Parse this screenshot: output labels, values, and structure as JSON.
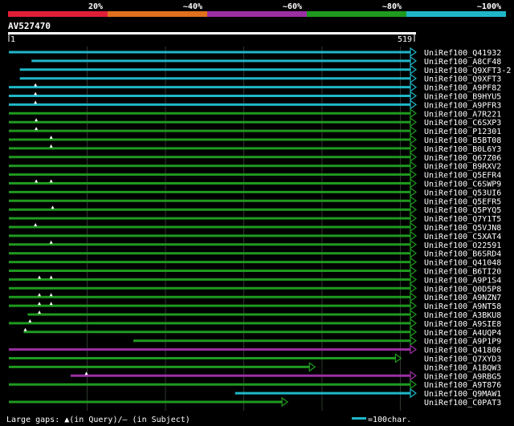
{
  "colors": {
    "background": "#000000",
    "text": "#ffffff",
    "grid": "#2e3a2e",
    "ruler": "#ffffff",
    "bin_lt20": "#e01e37",
    "bin_40": "#e0701e",
    "bin_60": "#9b2fa3",
    "bin_80": "#1f9a1f",
    "bin_100": "#1fb7c8"
  },
  "legend": {
    "bins": [
      {
        "label": "20%",
        "color": "#e01e37"
      },
      {
        "label": "~40%",
        "color": "#e0701e"
      },
      {
        "label": "~60%",
        "color": "#9b2fa3"
      },
      {
        "label": "~80%",
        "color": "#1f9a1f"
      },
      {
        "label": "~100%",
        "color": "#1fb7c8"
      }
    ]
  },
  "query": {
    "name": "AV527470",
    "start_label": "1",
    "end_label": "519",
    "length": 519
  },
  "footer": {
    "gaps_text": "Large gaps: ▲(in Query)/– (in Subject)",
    "scale_text": "=100char."
  },
  "chart_data": {
    "type": "alignment",
    "x_range": [
      1,
      519
    ],
    "hits": [
      {
        "name": "UniRef100_Q41932",
        "start": 1,
        "end": 519,
        "identity_bin": "~100%",
        "arrow": true
      },
      {
        "name": "UniRef100_A8CF48",
        "start": 30,
        "end": 519,
        "identity_bin": "~100%",
        "arrow": true
      },
      {
        "name": "UniRef100_Q9XFT3-2",
        "start": 15,
        "end": 519,
        "identity_bin": "~100%",
        "arrow": true
      },
      {
        "name": "UniRef100_Q9XFT3",
        "start": 15,
        "end": 519,
        "identity_bin": "~100%",
        "arrow": true
      },
      {
        "name": "UniRef100_A9PF82",
        "start": 1,
        "end": 519,
        "identity_bin": "~100%",
        "arrow": true,
        "query_gaps": [
          35
        ]
      },
      {
        "name": "UniRef100_B9HYU5",
        "start": 1,
        "end": 519,
        "identity_bin": "~100%",
        "arrow": true,
        "query_gaps": [
          35
        ]
      },
      {
        "name": "UniRef100_A9PFR3",
        "start": 1,
        "end": 519,
        "identity_bin": "~100%",
        "arrow": true,
        "query_gaps": [
          35
        ]
      },
      {
        "name": "UniRef100_A7R221",
        "start": 1,
        "end": 519,
        "identity_bin": "~80%",
        "arrow": true
      },
      {
        "name": "UniRef100_C6SXP3",
        "start": 1,
        "end": 519,
        "identity_bin": "~80%",
        "arrow": true,
        "query_gaps": [
          36
        ]
      },
      {
        "name": "UniRef100_P12301",
        "start": 1,
        "end": 519,
        "identity_bin": "~80%",
        "arrow": true,
        "query_gaps": [
          36
        ]
      },
      {
        "name": "UniRef100_B5BT08",
        "start": 1,
        "end": 519,
        "identity_bin": "~80%",
        "arrow": true,
        "query_gaps": [
          55
        ]
      },
      {
        "name": "UniRef100_B0L6Y3",
        "start": 1,
        "end": 519,
        "identity_bin": "~80%",
        "arrow": true,
        "query_gaps": [
          55
        ]
      },
      {
        "name": "UniRef100_Q67Z06",
        "start": 1,
        "end": 519,
        "identity_bin": "~80%",
        "arrow": true
      },
      {
        "name": "UniRef100_B9RXV2",
        "start": 1,
        "end": 519,
        "identity_bin": "~80%",
        "arrow": true
      },
      {
        "name": "UniRef100_Q5EFR4",
        "start": 1,
        "end": 519,
        "identity_bin": "~80%",
        "arrow": true
      },
      {
        "name": "UniRef100_C6SWP9",
        "start": 1,
        "end": 519,
        "identity_bin": "~80%",
        "arrow": true,
        "query_gaps": [
          36,
          55
        ]
      },
      {
        "name": "UniRef100_Q53UI6",
        "start": 1,
        "end": 519,
        "identity_bin": "~80%",
        "arrow": true
      },
      {
        "name": "UniRef100_Q5EFR5",
        "start": 1,
        "end": 519,
        "identity_bin": "~80%",
        "arrow": true
      },
      {
        "name": "UniRef100_Q5PYQ5",
        "start": 1,
        "end": 519,
        "identity_bin": "~80%",
        "arrow": true,
        "query_gaps": [
          57
        ]
      },
      {
        "name": "UniRef100_Q7Y1T5",
        "start": 1,
        "end": 519,
        "identity_bin": "~80%",
        "arrow": true
      },
      {
        "name": "UniRef100_Q5VJN8",
        "start": 1,
        "end": 519,
        "identity_bin": "~80%",
        "arrow": true,
        "query_gaps": [
          35
        ]
      },
      {
        "name": "UniRef100_C5XAT4",
        "start": 1,
        "end": 519,
        "identity_bin": "~80%",
        "arrow": true
      },
      {
        "name": "UniRef100_O22591",
        "start": 1,
        "end": 519,
        "identity_bin": "~80%",
        "arrow": true,
        "query_gaps": [
          55
        ]
      },
      {
        "name": "UniRef100_B6SRD4",
        "start": 1,
        "end": 519,
        "identity_bin": "~80%",
        "arrow": true
      },
      {
        "name": "UniRef100_Q41048",
        "start": 1,
        "end": 519,
        "identity_bin": "~80%",
        "arrow": true
      },
      {
        "name": "UniRef100_B6TI20",
        "start": 1,
        "end": 519,
        "identity_bin": "~80%",
        "arrow": true
      },
      {
        "name": "UniRef100_A9P1S4",
        "start": 1,
        "end": 519,
        "identity_bin": "~80%",
        "arrow": true,
        "query_gaps": [
          40,
          55
        ]
      },
      {
        "name": "UniRef100_Q0D5P8",
        "start": 1,
        "end": 519,
        "identity_bin": "~80%",
        "arrow": true
      },
      {
        "name": "UniRef100_A9NZN7",
        "start": 1,
        "end": 519,
        "identity_bin": "~80%",
        "arrow": true,
        "query_gaps": [
          40,
          55
        ]
      },
      {
        "name": "UniRef100_A9NT58",
        "start": 1,
        "end": 519,
        "identity_bin": "~80%",
        "arrow": true,
        "query_gaps": [
          40,
          55
        ]
      },
      {
        "name": "UniRef100_A3BKU8",
        "start": 25,
        "end": 519,
        "identity_bin": "~80%",
        "arrow": true,
        "query_gaps": [
          40
        ]
      },
      {
        "name": "UniRef100_A9SIE8",
        "start": 1,
        "end": 519,
        "identity_bin": "~80%",
        "arrow": true,
        "query_gaps": [
          28
        ]
      },
      {
        "name": "UniRef100_A4UQP4",
        "start": 20,
        "end": 519,
        "identity_bin": "~80%",
        "arrow": true,
        "query_gaps": [
          22
        ]
      },
      {
        "name": "UniRef100_A9P1P9",
        "start": 160,
        "end": 519,
        "identity_bin": "~80%",
        "arrow": true
      },
      {
        "name": "UniRef100_Q41806",
        "start": 1,
        "end": 519,
        "identity_bin": "~60%",
        "arrow": true
      },
      {
        "name": "UniRef100_Q7XYD3",
        "start": 1,
        "end": 500,
        "identity_bin": "~80%",
        "arrow": true
      },
      {
        "name": "UniRef100_A1BQW3",
        "start": 1,
        "end": 390,
        "identity_bin": "~80%",
        "arrow": true
      },
      {
        "name": "UniRef100_A9RBG5",
        "start": 80,
        "end": 519,
        "identity_bin": "~60%",
        "arrow": true,
        "query_gaps": [
          100
        ]
      },
      {
        "name": "UniRef100_A9T876",
        "start": 1,
        "end": 519,
        "identity_bin": "~80%",
        "arrow": true
      },
      {
        "name": "UniRef100_Q9MAW1",
        "start": 290,
        "end": 519,
        "identity_bin": "~100%",
        "arrow": true
      },
      {
        "name": "UniRef100_C0PAT3",
        "start": 1,
        "end": 355,
        "identity_bin": "~80%",
        "arrow": true
      }
    ]
  }
}
